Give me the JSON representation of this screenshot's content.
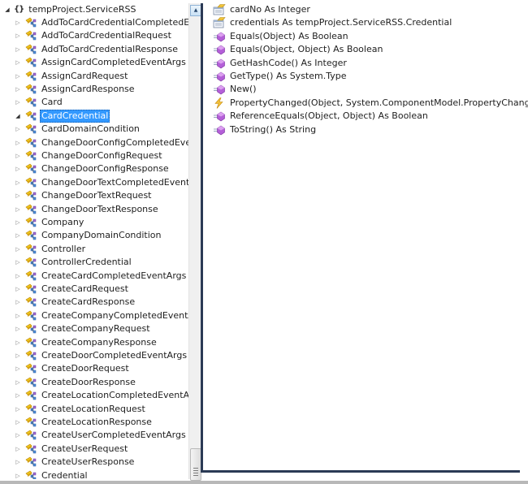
{
  "tree": {
    "root": {
      "label": "tempProject.ServiceRSS",
      "icon": "namespace-icon",
      "expanded": true
    },
    "items": [
      {
        "label": "AddToCardCredentialCompletedEventArgs",
        "expanded": false,
        "selected": false
      },
      {
        "label": "AddToCardCredentialRequest",
        "expanded": false,
        "selected": false
      },
      {
        "label": "AddToCardCredentialResponse",
        "expanded": false,
        "selected": false
      },
      {
        "label": "AssignCardCompletedEventArgs",
        "expanded": false,
        "selected": false
      },
      {
        "label": "AssignCardRequest",
        "expanded": false,
        "selected": false
      },
      {
        "label": "AssignCardResponse",
        "expanded": false,
        "selected": false
      },
      {
        "label": "Card",
        "expanded": false,
        "selected": false
      },
      {
        "label": "CardCredential",
        "expanded": true,
        "selected": true
      },
      {
        "label": "CardDomainCondition",
        "expanded": false,
        "selected": false
      },
      {
        "label": "ChangeDoorConfigCompletedEventArgs",
        "expanded": false,
        "selected": false
      },
      {
        "label": "ChangeDoorConfigRequest",
        "expanded": false,
        "selected": false
      },
      {
        "label": "ChangeDoorConfigResponse",
        "expanded": false,
        "selected": false
      },
      {
        "label": "ChangeDoorTextCompletedEventArgs",
        "expanded": false,
        "selected": false
      },
      {
        "label": "ChangeDoorTextRequest",
        "expanded": false,
        "selected": false
      },
      {
        "label": "ChangeDoorTextResponse",
        "expanded": false,
        "selected": false
      },
      {
        "label": "Company",
        "expanded": false,
        "selected": false
      },
      {
        "label": "CompanyDomainCondition",
        "expanded": false,
        "selected": false
      },
      {
        "label": "Controller",
        "expanded": false,
        "selected": false
      },
      {
        "label": "ControllerCredential",
        "expanded": false,
        "selected": false
      },
      {
        "label": "CreateCardCompletedEventArgs",
        "expanded": false,
        "selected": false
      },
      {
        "label": "CreateCardRequest",
        "expanded": false,
        "selected": false
      },
      {
        "label": "CreateCardResponse",
        "expanded": false,
        "selected": false
      },
      {
        "label": "CreateCompanyCompletedEventArgs",
        "expanded": false,
        "selected": false
      },
      {
        "label": "CreateCompanyRequest",
        "expanded": false,
        "selected": false
      },
      {
        "label": "CreateCompanyResponse",
        "expanded": false,
        "selected": false
      },
      {
        "label": "CreateDoorCompletedEventArgs",
        "expanded": false,
        "selected": false
      },
      {
        "label": "CreateDoorRequest",
        "expanded": false,
        "selected": false
      },
      {
        "label": "CreateDoorResponse",
        "expanded": false,
        "selected": false
      },
      {
        "label": "CreateLocationCompletedEventArgs",
        "expanded": false,
        "selected": false
      },
      {
        "label": "CreateLocationRequest",
        "expanded": false,
        "selected": false
      },
      {
        "label": "CreateLocationResponse",
        "expanded": false,
        "selected": false
      },
      {
        "label": "CreateUserCompletedEventArgs",
        "expanded": false,
        "selected": false
      },
      {
        "label": "CreateUserRequest",
        "expanded": false,
        "selected": false
      },
      {
        "label": "CreateUserResponse",
        "expanded": false,
        "selected": false
      },
      {
        "label": "Credential",
        "expanded": false,
        "selected": false
      }
    ]
  },
  "members": [
    {
      "label": "cardNo As Integer",
      "kind": "property"
    },
    {
      "label": "credentials As tempProject.ServiceRSS.Credential",
      "kind": "property"
    },
    {
      "label": "Equals(Object) As Boolean",
      "kind": "method"
    },
    {
      "label": "Equals(Object, Object) As Boolean",
      "kind": "method"
    },
    {
      "label": "GetHashCode() As Integer",
      "kind": "method"
    },
    {
      "label": "GetType() As System.Type",
      "kind": "method"
    },
    {
      "label": "New()",
      "kind": "method"
    },
    {
      "label": "PropertyChanged(Object, System.ComponentModel.PropertyChangedEventArgs)",
      "kind": "event"
    },
    {
      "label": "ReferenceEquals(Object, Object) As Boolean",
      "kind": "method"
    },
    {
      "label": "ToString() As String",
      "kind": "method"
    }
  ],
  "colors": {
    "selection": "#3399ff",
    "pane_border": "#2b3a55"
  }
}
